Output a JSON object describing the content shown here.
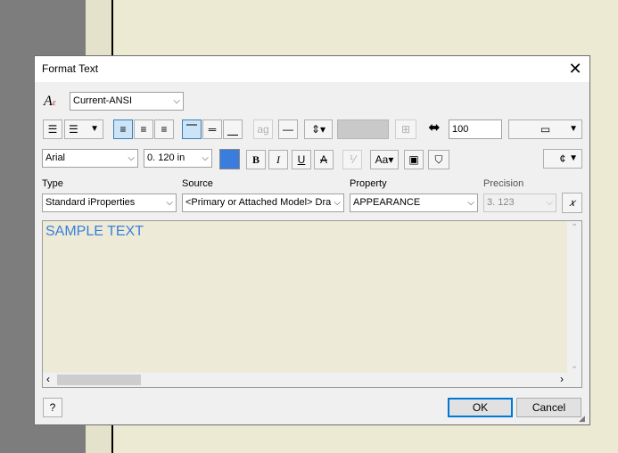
{
  "dialog": {
    "title": "Format Text"
  },
  "style_row": {
    "style_value": "Current-ANSI"
  },
  "toolbar1": {
    "stretch_value": "100"
  },
  "toolbar2": {
    "font_value": "Arial",
    "size_value": "0. 120 in",
    "text_color": "#3b7ddd",
    "bold_label": "B",
    "italic_label": "I",
    "underline_label": "U",
    "strike_label": "A",
    "symbol_label": "¢"
  },
  "fields": {
    "type_label": "Type",
    "type_value": "Standard iProperties",
    "source_label": "Source",
    "source_value": "<Primary or Attached Model> Dra",
    "property_label": "Property",
    "property_value": "APPEARANCE",
    "precision_label": "Precision",
    "precision_value": "3. 123"
  },
  "editor": {
    "text": "SAMPLE TEXT"
  },
  "buttons": {
    "ok": "OK",
    "cancel": "Cancel",
    "help_label": "?"
  }
}
